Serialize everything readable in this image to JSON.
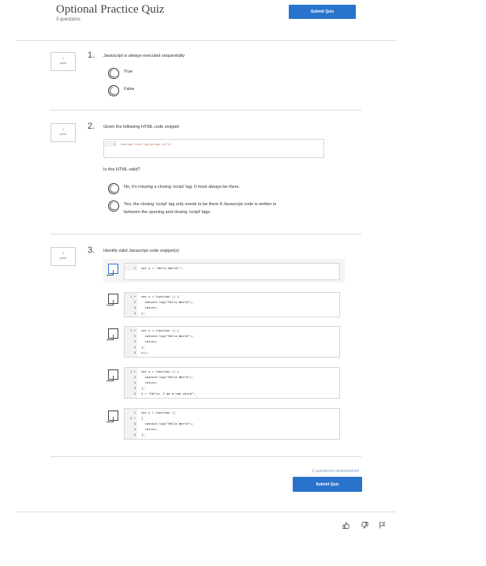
{
  "header": {
    "title": "Optional Practice Quiz",
    "subtitle": "3 questions",
    "submit_label": "Submit Quiz"
  },
  "questions": [
    {
      "points": "1",
      "points_label": "point",
      "number": "1.",
      "text": "Javascript is always executed sequentially",
      "options": [
        "True",
        "False"
      ]
    },
    {
      "points": "1",
      "points_label": "point",
      "number": "2.",
      "text": "Given the following HTML code snippet:",
      "code": [
        "<script src=\"js/script.js\"/>"
      ],
      "followup": "Is this HTML valid?",
      "options": [
        "No, it's missing a closing 'script' tag. It must always be there.",
        "Yes, the closing 'script' tag only needs to be there if Javascript code is written in",
        "between the opening and closing 'script' tags."
      ]
    },
    {
      "points": "1",
      "points_label": "point",
      "number": "3.",
      "text": "Identify valid Javascript code snippet(s)",
      "snippets": [
        {
          "lines": [
            "var x = \"Hello World!\";"
          ]
        },
        {
          "lines": [
            "var x = function () {",
            "  console.log(\"Hello World\");",
            "  return;",
            "};"
          ]
        },
        {
          "lines": [
            "var x = function () {",
            "  console.log(\"Hello World\");",
            "  return;",
            "};",
            "x();"
          ]
        },
        {
          "lines": [
            "var x = function () {",
            "  console.log(\"Hello World\");",
            "  return;",
            "};",
            "x = \"Hello, I am a new value\";"
          ]
        },
        {
          "lines": [
            "var x = function ()",
            "{",
            "  console.log(\"Hello World\");",
            "  return;",
            "};"
          ]
        }
      ]
    }
  ],
  "footer": {
    "unanswered": "2 questions unanswered",
    "submit_label": "Submit Quiz"
  },
  "gutter_numbers": [
    "1",
    "2",
    "3",
    "4",
    "5"
  ],
  "fold_marks": [
    "1 ▾",
    "2 ▾"
  ],
  "icons": [
    "thumbs-up-icon",
    "thumbs-down-icon",
    "flag-icon"
  ],
  "colors": {
    "accent": "#2a73cc"
  }
}
